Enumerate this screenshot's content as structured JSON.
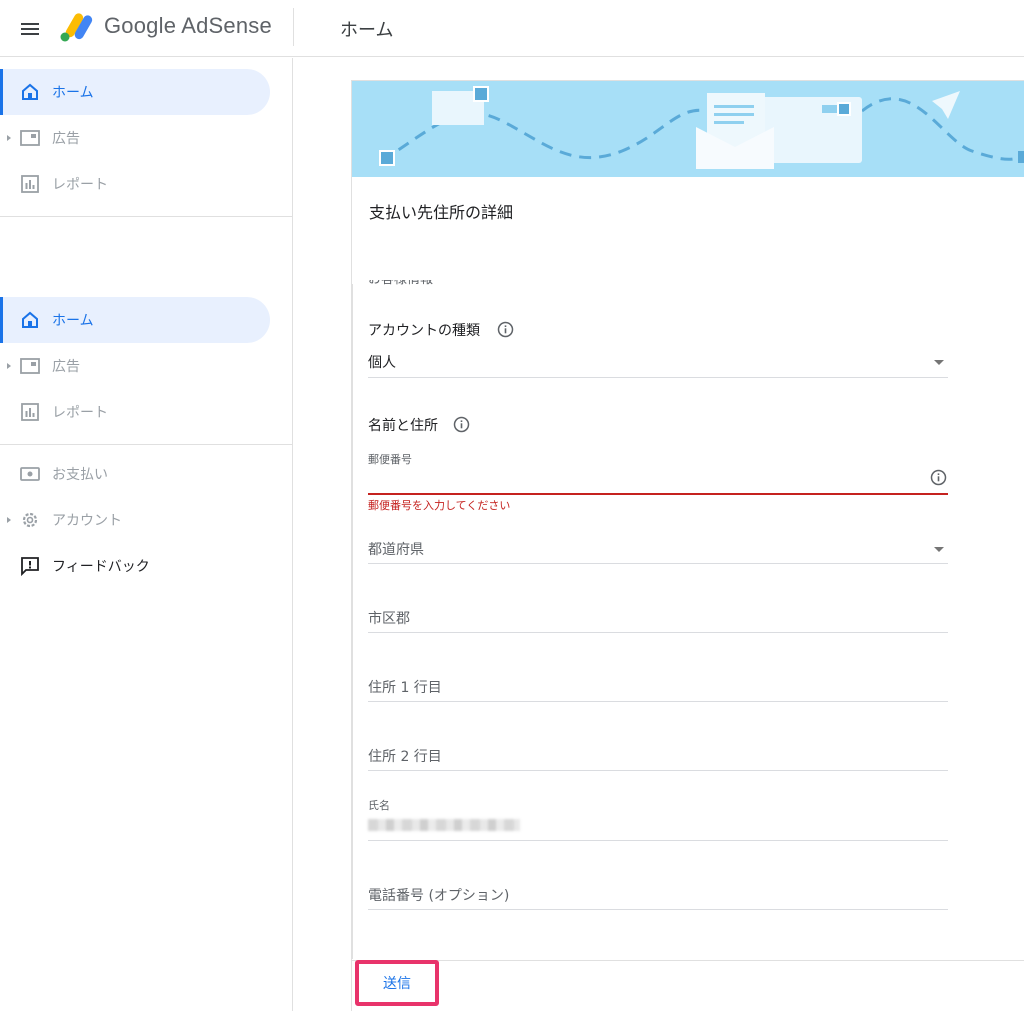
{
  "header": {
    "brand_text": "Google AdSense",
    "page_title": "ホーム"
  },
  "sidebar": {
    "group1": [
      {
        "label": "ホーム",
        "icon": "home-icon",
        "active": true
      },
      {
        "label": "広告",
        "icon": "ads-icon"
      },
      {
        "label": "レポート",
        "icon": "report-icon"
      }
    ],
    "group2": [
      {
        "label": "ホーム",
        "icon": "home-icon",
        "active": true
      },
      {
        "label": "広告",
        "icon": "ads-icon"
      },
      {
        "label": "レポート",
        "icon": "report-icon"
      }
    ],
    "group3": [
      {
        "label": "お支払い",
        "icon": "payments-icon"
      },
      {
        "label": "アカウント",
        "icon": "gear-icon"
      },
      {
        "label": "フィードバック",
        "icon": "feedback-icon"
      }
    ]
  },
  "card": {
    "title": "支払い先住所の詳細",
    "cut_section_title": "お客様情報"
  },
  "form": {
    "account_type_label": "アカウントの種類",
    "account_type_value": "個人",
    "name_address_label": "名前と住所",
    "postal_label": "郵便番号",
    "postal_error": "郵便番号を入力してください",
    "prefecture_placeholder": "都道府県",
    "city_placeholder": "市区郡",
    "address1_placeholder": "住所 1 行目",
    "address2_placeholder": "住所 2 行目",
    "name_label": "氏名",
    "phone_placeholder": "電話番号 (オプション)"
  },
  "footer": {
    "submit_label": "送信"
  },
  "colors": {
    "accent": "#1a73e8",
    "error": "#c5221f",
    "highlight": "#e8336b",
    "banner": "#a7dff7"
  }
}
